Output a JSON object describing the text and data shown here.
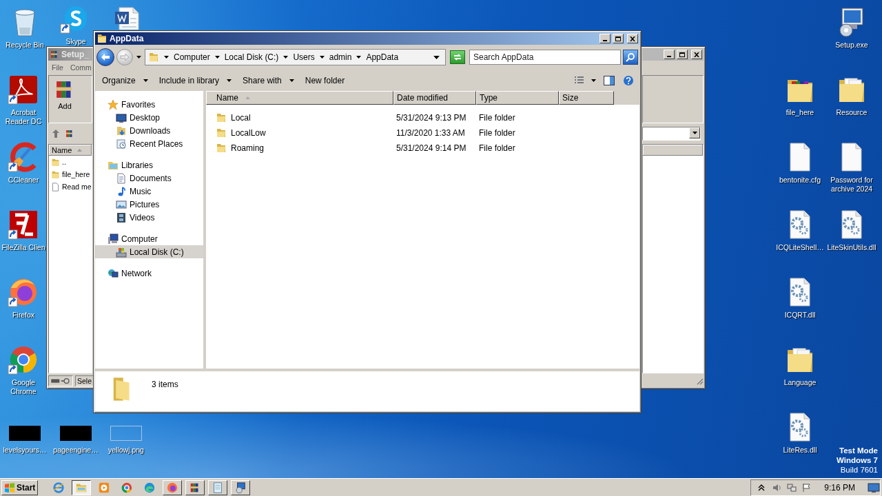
{
  "desktop_icons": [
    {
      "label": "Recycle Bin",
      "kind": "recycle",
      "shortcut": false
    },
    {
      "label": "Skype",
      "kind": "skype",
      "shortcut": true
    },
    {
      "kind": "word",
      "shortcut": false
    },
    {
      "label": "Acrobat Reader DC",
      "kind": "acrobat",
      "shortcut": true
    },
    {
      "label": "CCleaner",
      "kind": "ccleaner",
      "shortcut": true
    },
    {
      "label": "FileZilla Clien",
      "kind": "filezilla",
      "shortcut": true
    },
    {
      "label": "Firefox",
      "kind": "firefox",
      "shortcut": true
    },
    {
      "label": "Google Chrome",
      "kind": "chrome",
      "shortcut": true
    },
    {
      "label": "levelsyours…",
      "kind": "dark-thumb",
      "shortcut": false
    },
    {
      "label": "pageengine…",
      "kind": "dark-thumb",
      "shortcut": false
    },
    {
      "label": "yellowj.png",
      "kind": "light-thumb",
      "shortcut": false
    },
    {
      "label": "Setup.exe",
      "kind": "setup",
      "shortcut": false
    },
    {
      "label": "file_here",
      "kind": "archive-folder",
      "shortcut": false
    },
    {
      "label": "Resource",
      "kind": "docs-folder",
      "shortcut": false
    },
    {
      "label": "bentonite.cfg",
      "kind": "file",
      "shortcut": false
    },
    {
      "label": "Password for archive 2024",
      "kind": "file",
      "shortcut": false
    },
    {
      "label": "ICQLiteShell…",
      "kind": "dll",
      "shortcut": false
    },
    {
      "label": "LiteSkinUtils.dll",
      "kind": "dll",
      "shortcut": false
    },
    {
      "label": "ICQRT.dll",
      "kind": "dll",
      "shortcut": false
    },
    {
      "label": "Language",
      "kind": "docs-folder",
      "shortcut": false
    },
    {
      "label": "LiteRes.dll",
      "kind": "dll",
      "shortcut": false
    }
  ],
  "background_window": {
    "title": "Setup_",
    "menu": [
      "File",
      "Comm"
    ],
    "toolbar_button": "Add",
    "column": "Name",
    "rows": [
      {
        "name": "..",
        "kind": "folder"
      },
      {
        "name": "file_here",
        "kind": "folder"
      },
      {
        "name": "Read me",
        "kind": "file"
      }
    ],
    "status": "Sele"
  },
  "explorer": {
    "title": "AppData",
    "breadcrumb": [
      "Computer",
      "Local Disk (C:)",
      "Users",
      "admin",
      "AppData"
    ],
    "search": {
      "placeholder": "Search AppData"
    },
    "toolbar": [
      {
        "label": "Organize",
        "dropdown": true
      },
      {
        "label": "Include in library",
        "dropdown": true
      },
      {
        "label": "Share with",
        "dropdown": true
      },
      {
        "label": "New folder",
        "dropdown": false
      }
    ],
    "nav": [
      {
        "label": "Favorites",
        "kind": "star",
        "selected": false,
        "children": [
          {
            "label": "Desktop",
            "kind": "desktop",
            "selected": false
          },
          {
            "label": "Downloads",
            "kind": "downloads",
            "selected": false
          },
          {
            "label": "Recent Places",
            "kind": "recent",
            "selected": false
          }
        ]
      },
      {
        "label": "Libraries",
        "kind": "library",
        "selected": false,
        "children": [
          {
            "label": "Documents",
            "kind": "documents",
            "selected": false
          },
          {
            "label": "Music",
            "kind": "music",
            "selected": false
          },
          {
            "label": "Pictures",
            "kind": "pictures",
            "selected": false
          },
          {
            "label": "Videos",
            "kind": "videos",
            "selected": false
          }
        ]
      },
      {
        "label": "Computer",
        "kind": "computer",
        "selected": false,
        "children": [
          {
            "label": "Local Disk (C:)",
            "kind": "disk",
            "selected": true
          }
        ]
      },
      {
        "label": "Network",
        "kind": "network",
        "selected": false
      }
    ],
    "columns": [
      {
        "label": "Name",
        "sorted": true
      },
      {
        "label": "Date modified",
        "sorted": false
      },
      {
        "label": "Type",
        "sorted": false
      },
      {
        "label": "Size",
        "sorted": false
      }
    ],
    "files": [
      {
        "name": "Local",
        "date_modified": "5/31/2024 9:13 PM",
        "type": "File folder"
      },
      {
        "name": "LocalLow",
        "date_modified": "11/3/2020 1:33 AM",
        "type": "File folder"
      },
      {
        "name": "Roaming",
        "date_modified": "5/31/2024 9:14 PM",
        "type": "File folder"
      }
    ],
    "status": "3 items"
  },
  "system_notice": [
    "Test Mode",
    "Windows 7",
    "Build 7601"
  ],
  "taskbar": {
    "start": "Start",
    "apps": [
      {
        "kind": "ie",
        "open": false,
        "active": false
      },
      {
        "kind": "explorer",
        "open": true,
        "active": true
      },
      {
        "kind": "media",
        "open": false,
        "active": false
      },
      {
        "kind": "chrome",
        "open": false,
        "active": false
      },
      {
        "kind": "edge",
        "open": false,
        "active": false
      },
      {
        "kind": "firefox",
        "open": true,
        "active": false
      },
      {
        "kind": "winrar",
        "open": true,
        "active": false
      },
      {
        "kind": "notepad",
        "open": true,
        "active": false
      },
      {
        "kind": "setup",
        "open": true,
        "active": false
      }
    ],
    "clock": "9:16 PM"
  }
}
